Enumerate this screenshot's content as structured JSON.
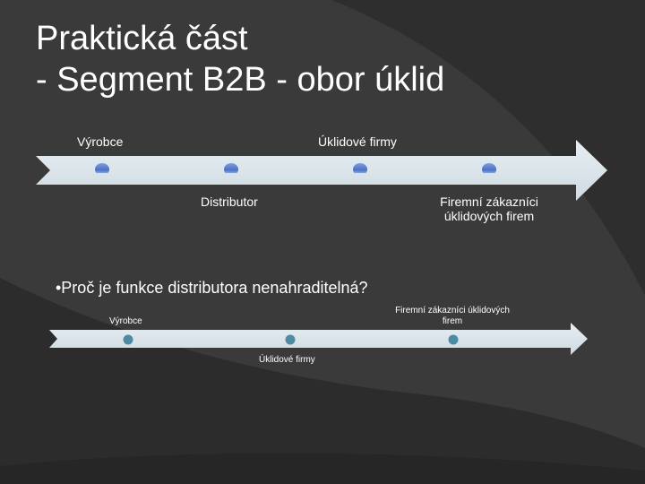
{
  "slide": {
    "title_line1": "Praktická část",
    "title_line2": "- Segment B2B - obor úklid",
    "bullet": "•Proč je funkce distributora nenahraditelná?"
  },
  "timeline1": {
    "labels": {
      "vyrobce": "Výrobce",
      "uklidove_firmy": "Úklidové firmy",
      "distributor": "Distributor",
      "firemni_line1": "Firemní zákazníci",
      "firemni_line2": "úklidových firem"
    }
  },
  "timeline2": {
    "labels": {
      "vyrobce": "Výrobce",
      "firemni_line1": "Firemní zákazníci úklidových",
      "firemni_line2": "firem",
      "uklidove_firmy": "Úklidové firmy"
    }
  },
  "colors": {
    "background": "#3a3a3a",
    "arc_dark": "#2a2a2a",
    "arrow_fill": "#dde8ee",
    "text": "#ffffff",
    "dot_blue": "#4a72c4",
    "dot_teal": "#4f8aa3"
  }
}
